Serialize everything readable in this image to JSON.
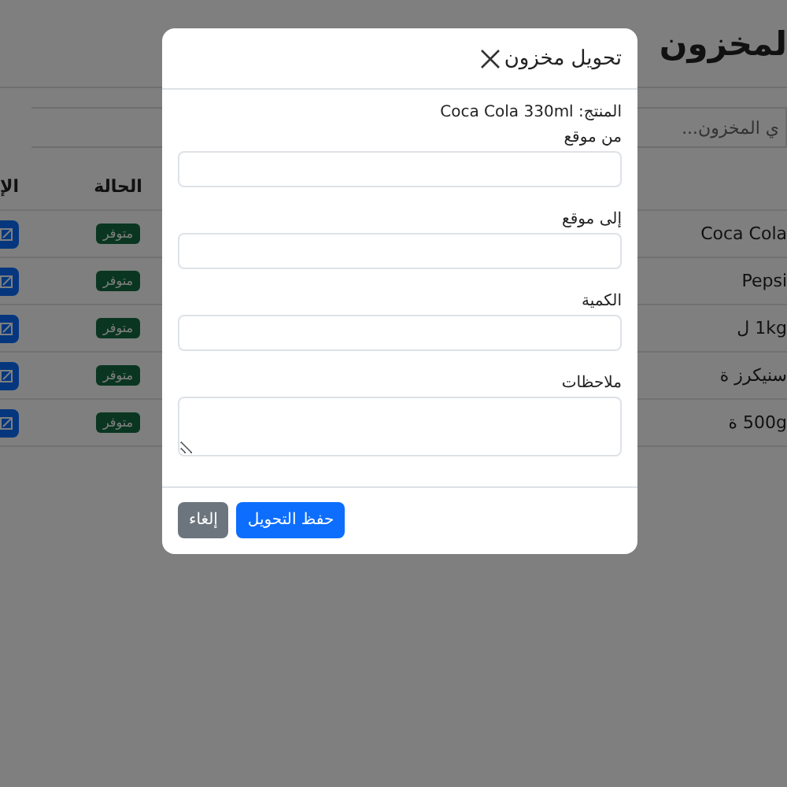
{
  "page": {
    "title": "لمخزون",
    "search": {
      "placeholder": "ي المخزون..."
    },
    "table": {
      "columns": [
        "الحالة",
        "الإ"
      ],
      "rows": [
        {
          "product": "Coca Cola",
          "status": "متوفر"
        },
        {
          "product": "Pepsi",
          "status": "متوفر"
        },
        {
          "product": "1kg ل",
          "status": "متوفر"
        },
        {
          "product": "سنيكرز ة",
          "status": "متوفر"
        },
        {
          "product": "500g ة",
          "status": "متوفر"
        }
      ]
    }
  },
  "modal": {
    "title": "تحويل مخزون",
    "product": "المنتج: Coca Cola 330ml",
    "fields": [
      {
        "label": "من موقع",
        "kind": "input"
      },
      {
        "label": "إلى موقع",
        "kind": "input"
      },
      {
        "label": "الكمية",
        "kind": "input"
      },
      {
        "label": "ملاحظات",
        "kind": "textarea"
      }
    ],
    "buttons": [
      {
        "label": "حفظ التحويل",
        "kind": "primary"
      },
      {
        "label": "إلغاء",
        "kind": "secondary"
      }
    ]
  }
}
